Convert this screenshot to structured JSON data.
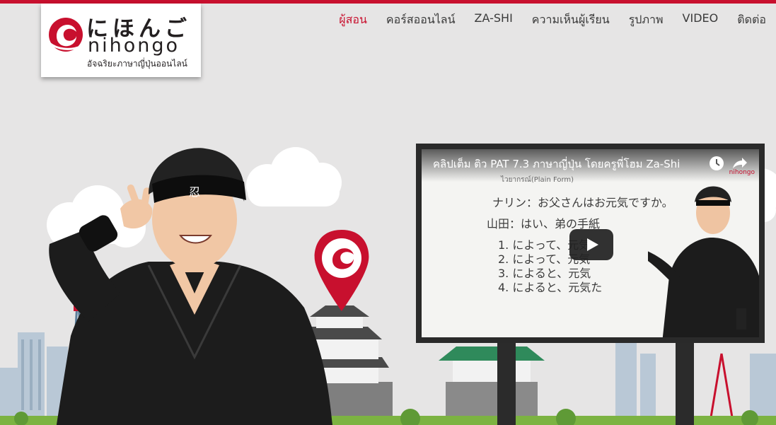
{
  "logo": {
    "jp_text": "にほんご",
    "en_text": "nihongo",
    "tagline": "อัจฉริยะภาษาญี่ปุ่นออนไลน์"
  },
  "nav": {
    "items": [
      {
        "label": "ผู้สอน",
        "active": true
      },
      {
        "label": "คอร์สออนไลน์",
        "active": false
      },
      {
        "label": "ZA-SHI",
        "active": false
      },
      {
        "label": "ความเห็นผู้เรียน",
        "active": false
      },
      {
        "label": "รูปภาพ",
        "active": false
      },
      {
        "label": "VIDEO",
        "active": false
      },
      {
        "label": "ติดต่อ",
        "active": false
      }
    ]
  },
  "video": {
    "title": "คลิปเต็ม ติว PAT 7.3 ภาษาญี่ปุ่น โดยครูพี่โฮม Za-Shi",
    "watch_later_icon": "clock-icon",
    "share_icon": "share-icon",
    "watermark": "nihongo",
    "whiteboard": {
      "heading": "ไวยากรณ์(Plain Form)",
      "line1": "ナリン：お父さんはお元気ですか。",
      "line2": "山田：はい、弟の手紙",
      "item1": "1. によって、元気",
      "item2": "2. によって、元気",
      "item3": "3. によると、元気",
      "item4": "4. によると、元気た"
    }
  },
  "colors": {
    "brand_red": "#c8102e",
    "background": "#e6e5e5",
    "billboard": "#2a2a2a"
  },
  "icons": {
    "headband_symbol": "忍"
  }
}
